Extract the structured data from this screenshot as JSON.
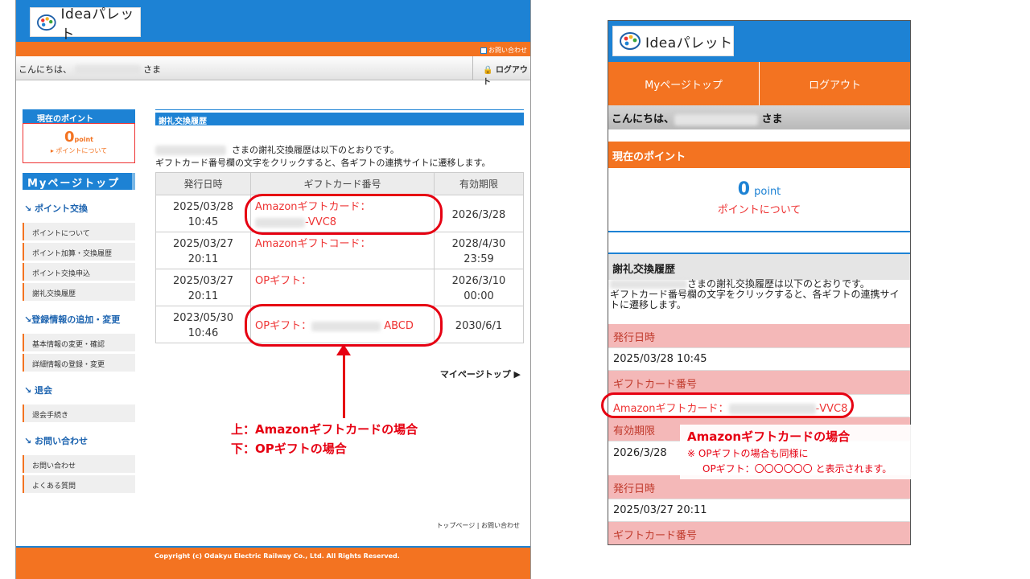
{
  "desktop": {
    "logo": "Ideaパレット",
    "contact_top": "お問い合わせ",
    "greeting_prefix": "こんにちは、",
    "greeting_suffix": "さま",
    "logout": "ログアウト",
    "sidebar": {
      "points_title": "現在のポイント",
      "points_value": "0",
      "points_unit": "point",
      "points_link": "ポイントについて",
      "mypage_top": "Myページトップ",
      "sections": [
        {
          "title": "ポイント交換",
          "items": [
            "ポイントについて",
            "ポイント加算・交換履歴",
            "ポイント交換申込",
            "謝礼交換履歴"
          ]
        },
        {
          "title": "登録情報の追加・変更",
          "items": [
            "基本情報の変更・確認",
            "詳細情報の登録・変更"
          ]
        },
        {
          "title": "退会",
          "items": [
            "退会手続き"
          ]
        },
        {
          "title": "お問い合わせ",
          "items": [
            "お問い合わせ",
            "よくある質問"
          ]
        }
      ]
    },
    "main": {
      "heading": "謝礼交換履歴",
      "intro_line1": "さまの謝礼交換履歴は以下のとおりです。",
      "intro_line2": "ギフトカード番号欄の文字をクリックすると、各ギフトの連携サイトに遷移します。",
      "columns": [
        "発行日時",
        "ギフトカード番号",
        "有効期限"
      ],
      "rows": [
        {
          "date1": "2025/03/28",
          "date2": "10:45",
          "gift1": "Amazonギフトカード：",
          "gift2": "-VVC8",
          "exp1": "2026/3/28",
          "exp2": ""
        },
        {
          "date1": "2025/03/27",
          "date2": "20:11",
          "gift1": "Amazonギフトコード：",
          "gift2": "",
          "exp1": "2028/4/30",
          "exp2": "23:59"
        },
        {
          "date1": "2025/03/27",
          "date2": "20:11",
          "gift1": "OPギフト：",
          "gift2": "",
          "exp1": "2026/3/10",
          "exp2": "00:00"
        },
        {
          "date1": "2023/05/30",
          "date2": "10:46",
          "gift1": "OPギフト：",
          "gift2": "ABCD",
          "exp1": "2030/6/1",
          "exp2": ""
        }
      ],
      "mypage_top_link": "マイページトップ ▶"
    },
    "footer_links": "トップページ | お問い合わせ",
    "copyright": "Copyright (c) Odakyu Electric Railway Co., Ltd. All Rights Reserved."
  },
  "annotation": {
    "line1": "上：Amazonギフトカードの場合",
    "line2": "下：OPギフトの場合"
  },
  "mobile": {
    "logo": "Ideaパレット",
    "nav": [
      "Myページトップ",
      "ログアウト"
    ],
    "greeting_prefix": "こんにちは、",
    "greeting_suffix": "さま",
    "points_title": "現在のポイント",
    "points_value": "0",
    "points_unit": "point",
    "points_link": "ポイントについて",
    "history_title": "謝礼交換履歴",
    "intro_line1": "さまの謝礼交換履歴は以下のとおりです。",
    "intro_line2": "ギフトカード番号欄の文字をクリックすると、各ギフトの連携サイ",
    "intro_line3": "トに遷移します。",
    "rows": [
      {
        "label": "発行日時",
        "value": "2025/03/28 10:45"
      },
      {
        "label": "ギフトカード番号",
        "value_prefix": "Amazonギフトカード：",
        "value_suffix": "-VVC8"
      },
      {
        "label": "有効期限",
        "value": "2026/3/28"
      },
      {
        "label": "発行日時",
        "value": "2025/03/27 20:11"
      },
      {
        "label": "ギフトカード番号"
      }
    ],
    "callout_title": "Amazonギフトカードの場合",
    "callout_line1": "※ OPギフトの場合も同様に",
    "callout_line2": "OPギフト：〇〇〇〇〇〇 と表示されます。"
  }
}
